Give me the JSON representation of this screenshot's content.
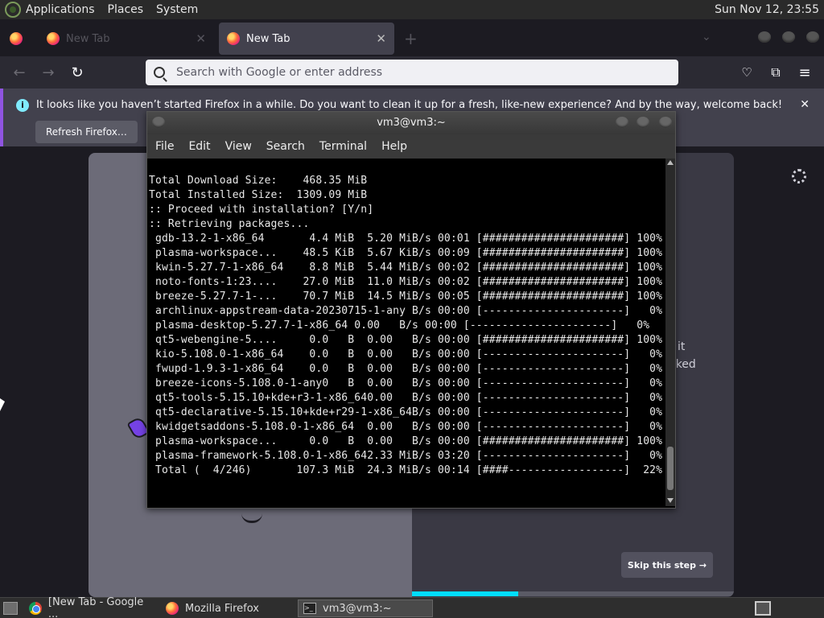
{
  "top_panel": {
    "menus": [
      "Applications",
      "Places",
      "System"
    ],
    "clock": "Sun Nov 12, 23:55"
  },
  "firefox": {
    "tabs": [
      {
        "label": "New Tab",
        "active": false
      },
      {
        "label": "New Tab",
        "active": true
      }
    ],
    "url_placeholder": "Search with Google or enter address",
    "notification": {
      "text": "It looks like you haven’t started Firefox in a while. Do you want to clean it up for a fresh, like-new experience? And by the way, welcome back!",
      "button": "Refresh Firefox…"
    },
    "welcome": {
      "partial_text_line1": "it",
      "partial_text_line2": "cked",
      "skip_label": "Skip this step →",
      "progress_fraction": 0.33
    }
  },
  "terminal": {
    "title": "vm3@vm3:~",
    "menu": [
      "File",
      "Edit",
      "View",
      "Search",
      "Terminal",
      "Help"
    ],
    "lines": [
      "Total Download Size:    468.35 MiB",
      "Total Installed Size:  1309.09 MiB",
      "",
      ":: Proceed with installation? [Y/n]",
      ":: Retrieving packages...",
      " gdb-13.2-1-x86_64       4.4 MiB  5.20 MiB/s 00:01 [######################] 100%",
      " plasma-workspace...    48.5 KiB  5.67 KiB/s 00:09 [######################] 100%",
      " kwin-5.27.7-1-x86_64    8.8 MiB  5.44 MiB/s 00:02 [######################] 100%",
      " noto-fonts-1:23....    27.0 MiB  11.0 MiB/s 00:02 [######################] 100%",
      " breeze-5.27.7-1-...    70.7 MiB  14.5 MiB/s 00:05 [######################] 100%",
      " archlinux-appstream-data-20230715-1-any B/s 00:00 [----------------------]   0%",
      " plasma-desktop-5.27.7-1-x86_64 0.00   B/s 00:00 [----------------------]   0%",
      " qt5-webengine-5....     0.0   B  0.00   B/s 00:00 [######################] 100%",
      " kio-5.108.0-1-x86_64    0.0   B  0.00   B/s 00:00 [----------------------]   0%",
      " fwupd-1.9.3-1-x86_64    0.0   B  0.00   B/s 00:00 [----------------------]   0%",
      " breeze-icons-5.108.0-1-any0   B  0.00   B/s 00:00 [----------------------]   0%",
      " qt5-tools-5.15.10+kde+r3-1-x86_640.00   B/s 00:00 [----------------------]   0%",
      " qt5-declarative-5.15.10+kde+r29-1-x86_64B/s 00:00 [----------------------]   0%",
      " kwidgetsaddons-5.108.0-1-x86_64  0.00   B/s 00:00 [----------------------]   0%",
      " plasma-workspace...     0.0   B  0.00   B/s 00:00 [######################] 100%",
      " plasma-framework-5.108.0-1-x86_642.33 MiB/s 03:20 [----------------------]   0%",
      " Total (  4/246)       107.3 MiB  24.3 MiB/s 00:14 [####------------------]  22%"
    ]
  },
  "taskbar": {
    "items": [
      {
        "label": "[New Tab - Google ...",
        "icon": "chrome-icon"
      },
      {
        "label": "Mozilla Firefox",
        "icon": "firefox-icon"
      },
      {
        "label": "vm3@vm3:~",
        "icon": "terminal-icon"
      }
    ]
  },
  "colors": {
    "accent_purple": "#8f54e0",
    "progress_cyan": "#00ddff"
  }
}
